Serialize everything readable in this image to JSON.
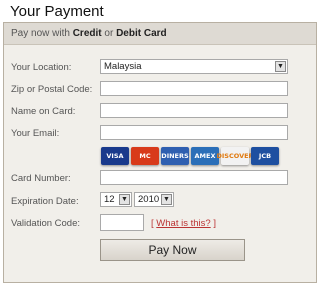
{
  "page": {
    "title": "Your Payment"
  },
  "panel": {
    "header_prefix": "Pay now with",
    "header_credit": "Credit",
    "header_or": "or",
    "header_debit": "Debit Card"
  },
  "form": {
    "location_label": "Your Location:",
    "location_value": "Malaysia",
    "zip_label": "Zip or Postal Code:",
    "zip_value": "",
    "name_label": "Name on Card:",
    "name_value": "",
    "email_label": "Your Email:",
    "email_value": "",
    "card_number_label": "Card Number:",
    "card_number_value": "",
    "expiration_label": "Expiration Date:",
    "exp_month": "12",
    "exp_year": "2010",
    "validation_label": "Validation Code:",
    "validation_value": "",
    "help_open": "[",
    "help_link": "What is this?",
    "help_close": "]",
    "submit_label": "Pay Now"
  },
  "cards": [
    {
      "name": "VISA",
      "bg": "#1a3a8c",
      "fg": "#ffffff"
    },
    {
      "name": "MC",
      "bg": "#d83a1a",
      "fg": "#ffffff"
    },
    {
      "name": "DINERS",
      "bg": "#2f5fb0",
      "fg": "#ffffff"
    },
    {
      "name": "AMEX",
      "bg": "#2b6fb8",
      "fg": "#ffffff"
    },
    {
      "name": "DISCOVER",
      "bg": "#f2f2f2",
      "fg": "#e07a10"
    },
    {
      "name": "JCB",
      "bg": "#1e4fa0",
      "fg": "#ffffff"
    }
  ]
}
